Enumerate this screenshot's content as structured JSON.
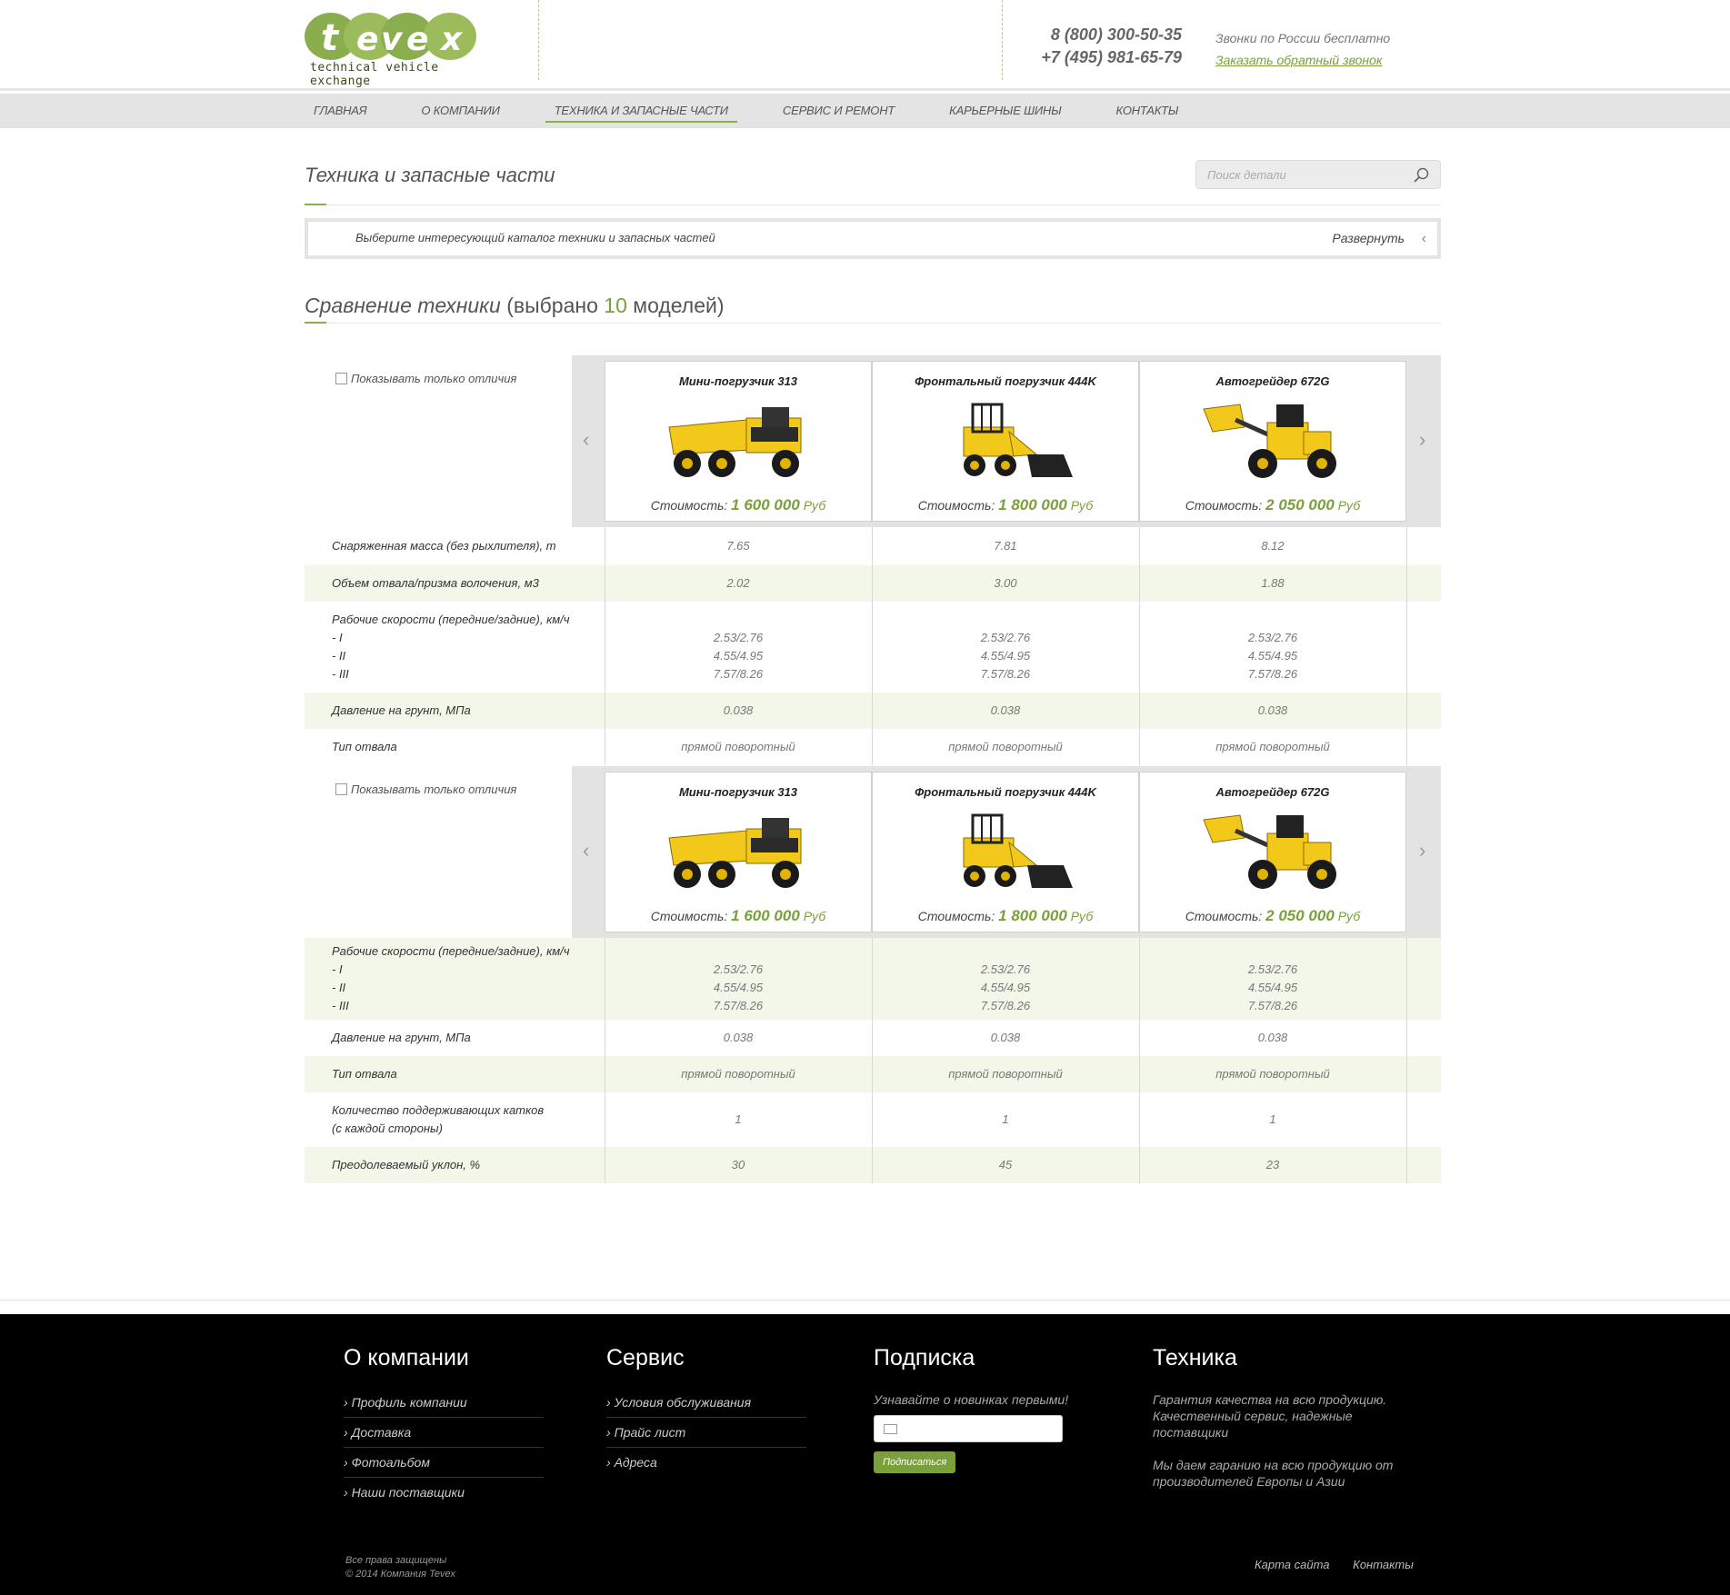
{
  "header": {
    "logo_text": "tevex",
    "logo_tagline": "technical vehicle exchange",
    "phone1": "8 (800) 300-50-35",
    "phone2": "+7 (495) 981-65-79",
    "calls_free": "Звонки по России бесплатно",
    "callback_link": "Заказать обратный звонок"
  },
  "nav": [
    "Главная",
    "О компании",
    "Техника и запасные части",
    "Сервис и ремонт",
    "Карьерные шины",
    "Контакты"
  ],
  "page": {
    "title": "Техника и запасные части",
    "search_placeholder": "Поиск детали",
    "catalog_text": "Выберите интересующий каталог техники и запасных частей",
    "expand_label": "Развернуть",
    "compare_title_a": "Сравнение техники",
    "compare_title_b": " (выбрано ",
    "compare_count": "10",
    "compare_title_c": " моделей)",
    "only_diff": "Показывать только отличия",
    "price_label": "Стоимость:",
    "currency": "Руб"
  },
  "products": [
    {
      "name": "Мини-погрузчик 313",
      "price": "1 600 000",
      "icon": "dump-truck-icon"
    },
    {
      "name": "Фронтальный погрузчик 444K",
      "price": "1 800 000",
      "icon": "skid-steer-icon"
    },
    {
      "name": "Автогрейдер 672G",
      "price": "2 050 000",
      "icon": "wheel-loader-icon"
    }
  ],
  "specs1": [
    {
      "label": "Снаряженная масса (без рыхлителя), т",
      "values": [
        "7.65",
        "7.81",
        "8.12"
      ]
    },
    {
      "label": "Объем отвала/призма волочения, м3",
      "values": [
        "2.02",
        "3.00",
        "1.88"
      ]
    },
    {
      "label": "Рабочие скорости (передние/задние), км/ч\n- I\n- II\n- III",
      "values": [
        "\n2.53/2.76\n4.55/4.95\n7.57/8.26",
        "\n2.53/2.76\n4.55/4.95\n7.57/8.26",
        "\n2.53/2.76\n4.55/4.95\n7.57/8.26"
      ]
    },
    {
      "label": "Давление на грунт, МПа",
      "values": [
        "0.038",
        "0.038",
        "0.038"
      ]
    },
    {
      "label": "Тип отвала",
      "values": [
        "прямой поворотный",
        "прямой поворотный",
        "прямой поворотный"
      ]
    }
  ],
  "specs2": [
    {
      "label": "Рабочие скорости (передние/задние), км/ч\n- I\n- II\n- III",
      "values": [
        "\n2.53/2.76\n4.55/4.95\n7.57/8.26",
        "\n2.53/2.76\n4.55/4.95\n7.57/8.26",
        "\n2.53/2.76\n4.55/4.95\n7.57/8.26"
      ]
    },
    {
      "label": "Давление на грунт, МПа",
      "values": [
        "0.038",
        "0.038",
        "0.038"
      ]
    },
    {
      "label": "Тип отвала",
      "values": [
        "прямой поворотный",
        "прямой поворотный",
        "прямой поворотный"
      ]
    },
    {
      "label": "Количество поддерживающих катков\n(с каждой стороны)",
      "values": [
        "1",
        "1",
        "1"
      ]
    },
    {
      "label": "Преодолеваемый уклон, %",
      "values": [
        "30",
        "45",
        "23"
      ]
    }
  ],
  "footer": {
    "col1_title": "О компании",
    "col1_links": [
      "Профиль компании",
      "Доставка",
      "Фотоальбом",
      "Наши поставщики"
    ],
    "col2_title": "Сервис",
    "col2_links": [
      "Условия обслуживания",
      "Прайс лист",
      "Адреса"
    ],
    "col3_title": "Подписка",
    "col3_text": "Узнавайте о новинках первыми!",
    "subscribe_button": "Подписаться",
    "col4_title": "Техника",
    "col4_p1": "Гарантия качества на всю продукцию. Качественный сервис, надежные поставщики",
    "col4_p2": "Мы даем гаранию на всю продукцию от производителей Европы и Азии",
    "copy1": "Все права защищены",
    "copy2": "© 2014 Компания Tevex",
    "link_sitemap": "Карта сайта",
    "link_contacts": "Контакты"
  },
  "colors": {
    "accent": "#79a03a",
    "nav_bg": "#e4e4e4",
    "footer_bg": "#000000",
    "row_alt": "#f3f7ea"
  }
}
